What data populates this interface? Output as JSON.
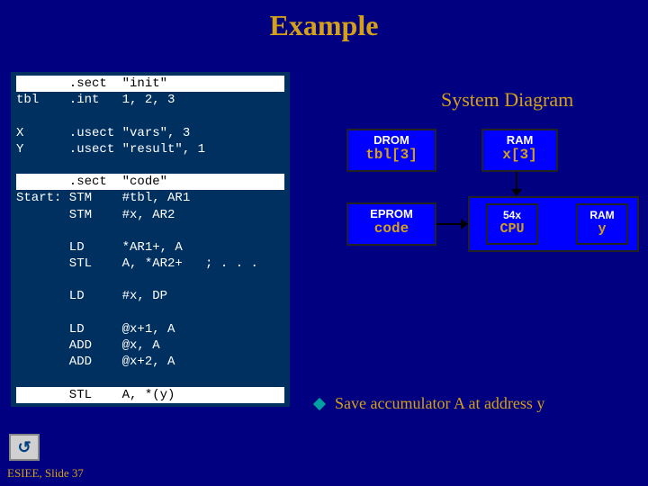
{
  "title": "Example",
  "subtitle": "System Diagram",
  "code_lines": [
    {
      "hl": true,
      "text": "       .sect  \"init\""
    },
    {
      "hl": false,
      "text": "tbl    .int   1, 2, 3"
    },
    {
      "hl": false,
      "text": ""
    },
    {
      "hl": false,
      "text": "X      .usect \"vars\", 3"
    },
    {
      "hl": false,
      "text": "Y      .usect \"result\", 1"
    },
    {
      "hl": false,
      "text": ""
    },
    {
      "hl": true,
      "text": "       .sect  \"code\""
    },
    {
      "hl": false,
      "text": "Start: STM    #tbl, AR1"
    },
    {
      "hl": false,
      "text": "       STM    #x, AR2"
    },
    {
      "hl": false,
      "text": ""
    },
    {
      "hl": false,
      "text": "       LD     *AR1+, A"
    },
    {
      "hl": false,
      "text": "       STL    A, *AR2+   ; . . ."
    },
    {
      "hl": false,
      "text": ""
    },
    {
      "hl": false,
      "text": "       LD     #x, DP"
    },
    {
      "hl": false,
      "text": ""
    },
    {
      "hl": false,
      "text": "       LD     @x+1, A"
    },
    {
      "hl": false,
      "text": "       ADD    @x, A"
    },
    {
      "hl": false,
      "text": "       ADD    @x+2, A"
    },
    {
      "hl": false,
      "text": ""
    },
    {
      "hl": true,
      "text": "       STL    A, *(y)"
    }
  ],
  "boxes": {
    "drom": {
      "lab1": "DROM",
      "lab2": "tbl[3]"
    },
    "ram_x": {
      "lab1": "RAM",
      "lab2": "x[3]"
    },
    "eprom": {
      "lab1": "EPROM",
      "lab2": "code"
    },
    "cpu": {
      "lab1": "54x",
      "lab2": "CPU"
    },
    "ram_y": {
      "lab1": "RAM",
      "lab2": "y"
    }
  },
  "bullet": "Save accumulator A at address y",
  "footer": "ESIEE, Slide 37",
  "nav_icon_glyph": "↺"
}
